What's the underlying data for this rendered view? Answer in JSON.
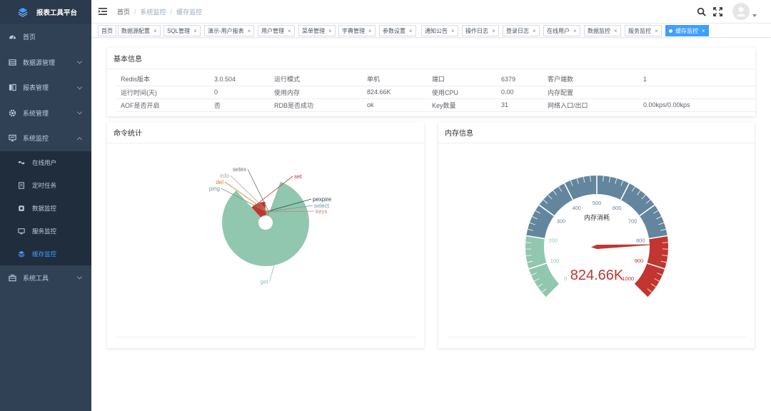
{
  "app": {
    "title": "报表工具平台"
  },
  "sidebar": {
    "items": [
      {
        "label": "首页",
        "icon": "dashboard-icon"
      },
      {
        "label": "数据源管理",
        "icon": "database-icon",
        "has_children": true
      },
      {
        "label": "报表管理",
        "icon": "report-icon",
        "has_children": true
      },
      {
        "label": "系统管理",
        "icon": "gear-icon",
        "has_children": true
      },
      {
        "label": "系统监控",
        "icon": "monitor-icon",
        "has_children": true,
        "expanded": true
      },
      {
        "label": "系统工具",
        "icon": "toolbox-icon",
        "has_children": true
      }
    ],
    "monitor_children": [
      {
        "label": "在线用户",
        "icon": "online-icon"
      },
      {
        "label": "定时任务",
        "icon": "job-icon"
      },
      {
        "label": "数据监控",
        "icon": "druid-icon"
      },
      {
        "label": "服务监控",
        "icon": "server-icon"
      },
      {
        "label": "缓存监控",
        "icon": "redis-icon",
        "active": true
      }
    ]
  },
  "header": {
    "breadcrumb": [
      "首页",
      "系统监控",
      "缓存监控"
    ]
  },
  "tags": [
    {
      "label": "首页",
      "closable": false
    },
    {
      "label": "数据源配置",
      "closable": true
    },
    {
      "label": "SQL管理",
      "closable": true
    },
    {
      "label": "演示-用户报表",
      "closable": true
    },
    {
      "label": "用户管理",
      "closable": true
    },
    {
      "label": "菜单管理",
      "closable": true
    },
    {
      "label": "字典管理",
      "closable": true
    },
    {
      "label": "参数设置",
      "closable": true
    },
    {
      "label": "通知公告",
      "closable": true
    },
    {
      "label": "操作日志",
      "closable": true
    },
    {
      "label": "登录日志",
      "closable": true
    },
    {
      "label": "在线用户",
      "closable": true
    },
    {
      "label": "数据监控",
      "closable": true
    },
    {
      "label": "服务监控",
      "closable": true
    },
    {
      "label": "缓存监控",
      "closable": true,
      "active": true
    }
  ],
  "basic_info": {
    "title": "基本信息",
    "rows": [
      [
        "Redis版本",
        "3.0.504",
        "运行模式",
        "单机",
        "端口",
        "6379",
        "客户端数",
        "1"
      ],
      [
        "运行时间(天)",
        "0",
        "使用内存",
        "824.66K",
        "使用CPU",
        "0.00",
        "内存配置",
        ""
      ],
      [
        "AOF是否开启",
        "否",
        "RDB是否成功",
        "ok",
        "Key数量",
        "31",
        "网络入口/出口",
        "0.00kps/0.00kps"
      ]
    ]
  },
  "command_card": {
    "title": "命令统计"
  },
  "memory_card": {
    "title": "内存信息"
  },
  "chart_data": [
    {
      "type": "pie",
      "variant": "rose",
      "categories": [
        "get",
        "set",
        "pexpire",
        "select",
        "keys",
        "ping",
        "del",
        "info",
        "setex"
      ],
      "values": [
        1000,
        140,
        10,
        10,
        10,
        10,
        10,
        10,
        10
      ],
      "colors": [
        "#91c7ae",
        "#c23531",
        "#2f4554",
        "#61a0a8",
        "#d48265",
        "#749f83",
        "#ca8622",
        "#bda29a",
        "#6e7074"
      ]
    },
    {
      "type": "gauge",
      "title": "内存消耗",
      "value": 824.66,
      "display_value": "824.66K",
      "min": 0,
      "max": 1000,
      "ticks": [
        0,
        100,
        200,
        300,
        400,
        500,
        600,
        700,
        800,
        900,
        1000
      ],
      "band_colors": [
        {
          "to": 0.2,
          "color": "#91c7ae"
        },
        {
          "to": 0.8,
          "color": "#63869e"
        },
        {
          "to": 1.0,
          "color": "#c23531"
        }
      ]
    }
  ]
}
